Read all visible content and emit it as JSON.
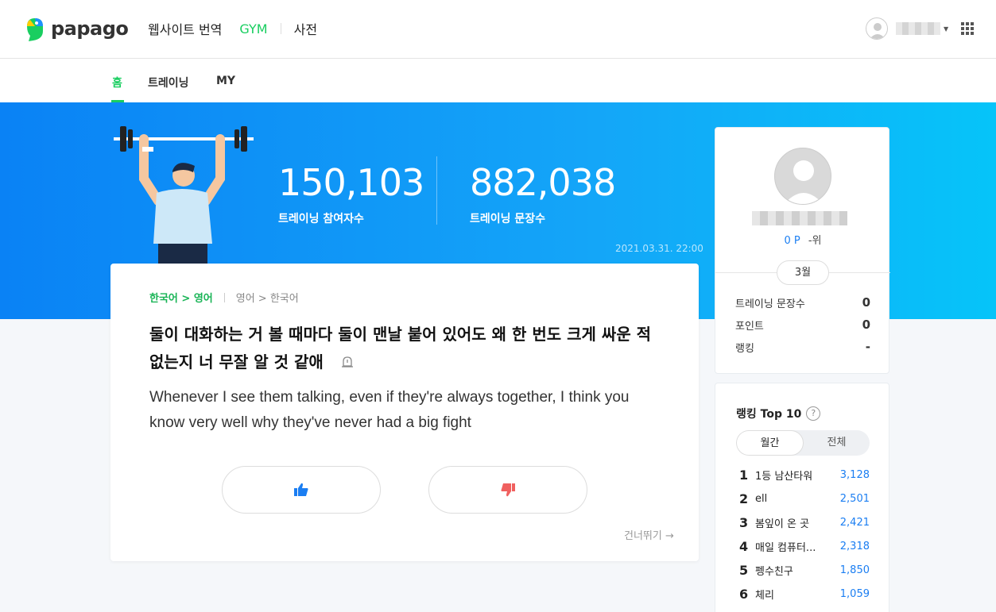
{
  "header": {
    "logo_text": "papago",
    "nav": {
      "website_translate": "웹사이트 번역",
      "gym": "GYM",
      "dictionary": "사전"
    }
  },
  "subnav": {
    "tabs": [
      "홈",
      "트레이닝",
      "MY"
    ]
  },
  "hero": {
    "participants_value": "150,103",
    "participants_label": "트레이닝 참여자수",
    "sentences_value": "882,038",
    "sentences_label": "트레이닝 문장수",
    "updated": "2021.03.31. 22:00"
  },
  "card": {
    "lang_active": "한국어 > 영어",
    "lang_inactive": "영어 > 한국어",
    "source_text": "둘이 대화하는 거 볼 때마다 둘이 맨날 붙어 있어도 왜 한 번도 크게 싸운 적 없는지 너 무잘 알 것 같애",
    "translation_text": "Whenever I see them talking, even if they're always together, I think you know very well why they've never had a big fight",
    "skip_label": "건너뛰기 →"
  },
  "profile": {
    "points": "0 P",
    "rank_text": "-위",
    "month": "3월",
    "rows": [
      {
        "label": "트레이닝 문장수",
        "value": "0"
      },
      {
        "label": "포인트",
        "value": "0"
      },
      {
        "label": "랭킹",
        "value": "-"
      }
    ]
  },
  "ranking": {
    "title": "랭킹 Top 10",
    "help": "?",
    "segments": [
      "월간",
      "전체"
    ],
    "entries": [
      {
        "rank": "1",
        "name": "1등 남산타워",
        "score": "3,128"
      },
      {
        "rank": "2",
        "name": "ell",
        "score": "2,501"
      },
      {
        "rank": "3",
        "name": "봄잎이 온 곳",
        "score": "2,421"
      },
      {
        "rank": "4",
        "name": "매일 컴퓨터...",
        "score": "2,318"
      },
      {
        "rank": "5",
        "name": "펭수친구",
        "score": "1,850"
      },
      {
        "rank": "6",
        "name": "체리",
        "score": "1,059"
      }
    ]
  },
  "colors": {
    "accent_green": "#19ce60",
    "hero_blue": "#0a82f5",
    "link_blue": "#1b7ef2",
    "dislike_red": "#f0605f"
  }
}
